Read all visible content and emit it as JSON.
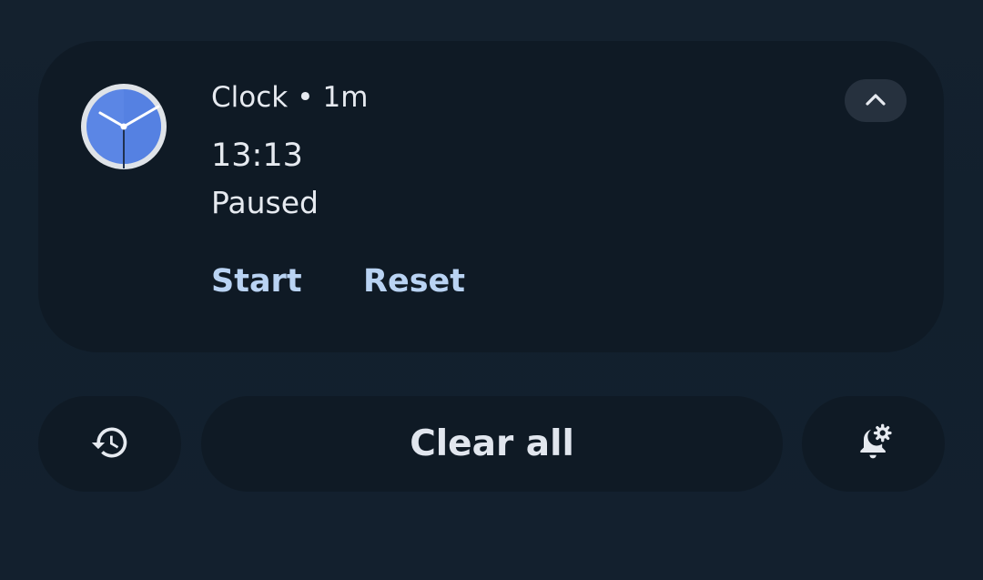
{
  "notification": {
    "app_name": "Clock",
    "separator": "•",
    "time_ago": "1m",
    "title": "13:13",
    "text": "Paused",
    "actions": {
      "start_label": "Start",
      "reset_label": "Reset"
    },
    "icon": "clock-app-icon",
    "collapse_icon": "chevron-up-icon"
  },
  "footer": {
    "history_icon": "history-icon",
    "clear_all_label": "Clear all",
    "settings_icon": "notification-settings-icon"
  },
  "colors": {
    "background": "#13202e",
    "card": "#0f1a25",
    "accent_text": "#b9d3f3",
    "clock_face": "#5b86e5"
  }
}
